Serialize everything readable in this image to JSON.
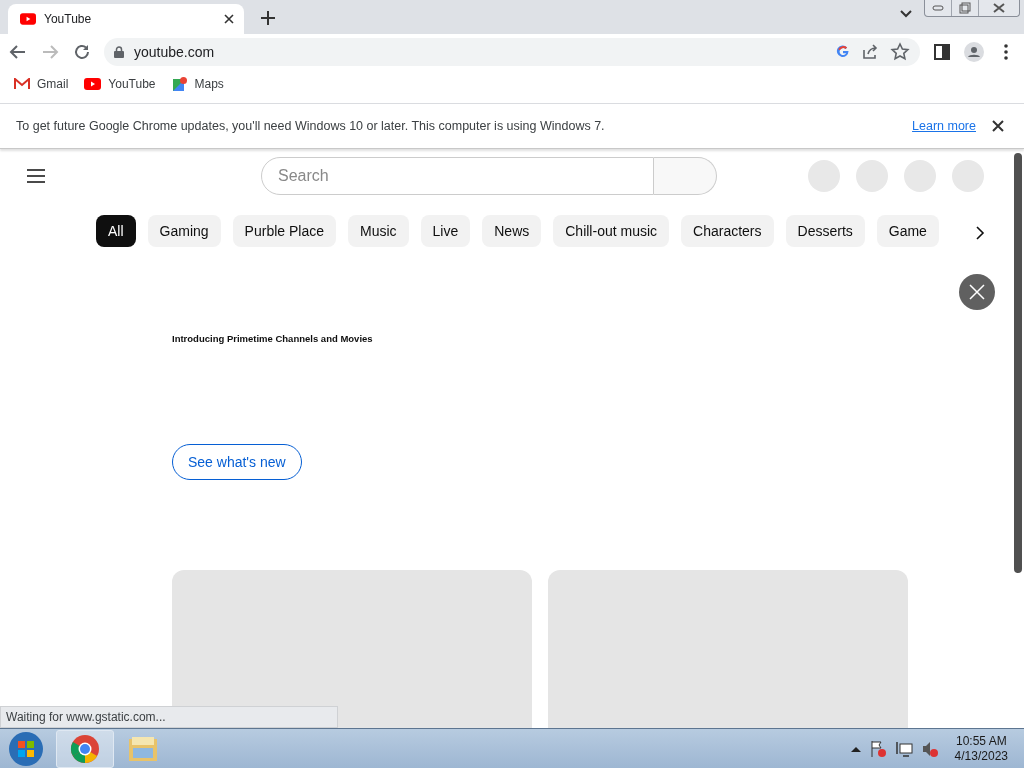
{
  "browser": {
    "tabs": [
      {
        "title": "YouTube",
        "selected": true
      }
    ],
    "address": "youtube.com",
    "bookmarks": [
      {
        "kind": "gmail",
        "label": "Gmail"
      },
      {
        "kind": "youtube",
        "label": "YouTube"
      },
      {
        "kind": "maps",
        "label": "Maps"
      }
    ],
    "infobar": {
      "message": "To get future Google Chrome updates, you'll need Windows 10 or later. This computer is using Windows 7.",
      "link": "Learn more"
    },
    "status": "Waiting for www.gstatic.com..."
  },
  "page": {
    "search": {
      "placeholder": "Search"
    },
    "chips": [
      {
        "label": "All",
        "selected": true
      },
      {
        "label": "Gaming",
        "selected": false
      },
      {
        "label": "Purble Place",
        "selected": false
      },
      {
        "label": "Music",
        "selected": false
      },
      {
        "label": "Live",
        "selected": false
      },
      {
        "label": "News",
        "selected": false
      },
      {
        "label": "Chill-out music",
        "selected": false
      },
      {
        "label": "Characters",
        "selected": false
      },
      {
        "label": "Desserts",
        "selected": false
      },
      {
        "label": "Game",
        "selected": false
      }
    ],
    "promo": {
      "title": "Introducing Primetime Channels and Movies",
      "button": "See what's new"
    }
  },
  "taskbar": {
    "time": "10:55 AM",
    "date": "4/13/2023"
  }
}
